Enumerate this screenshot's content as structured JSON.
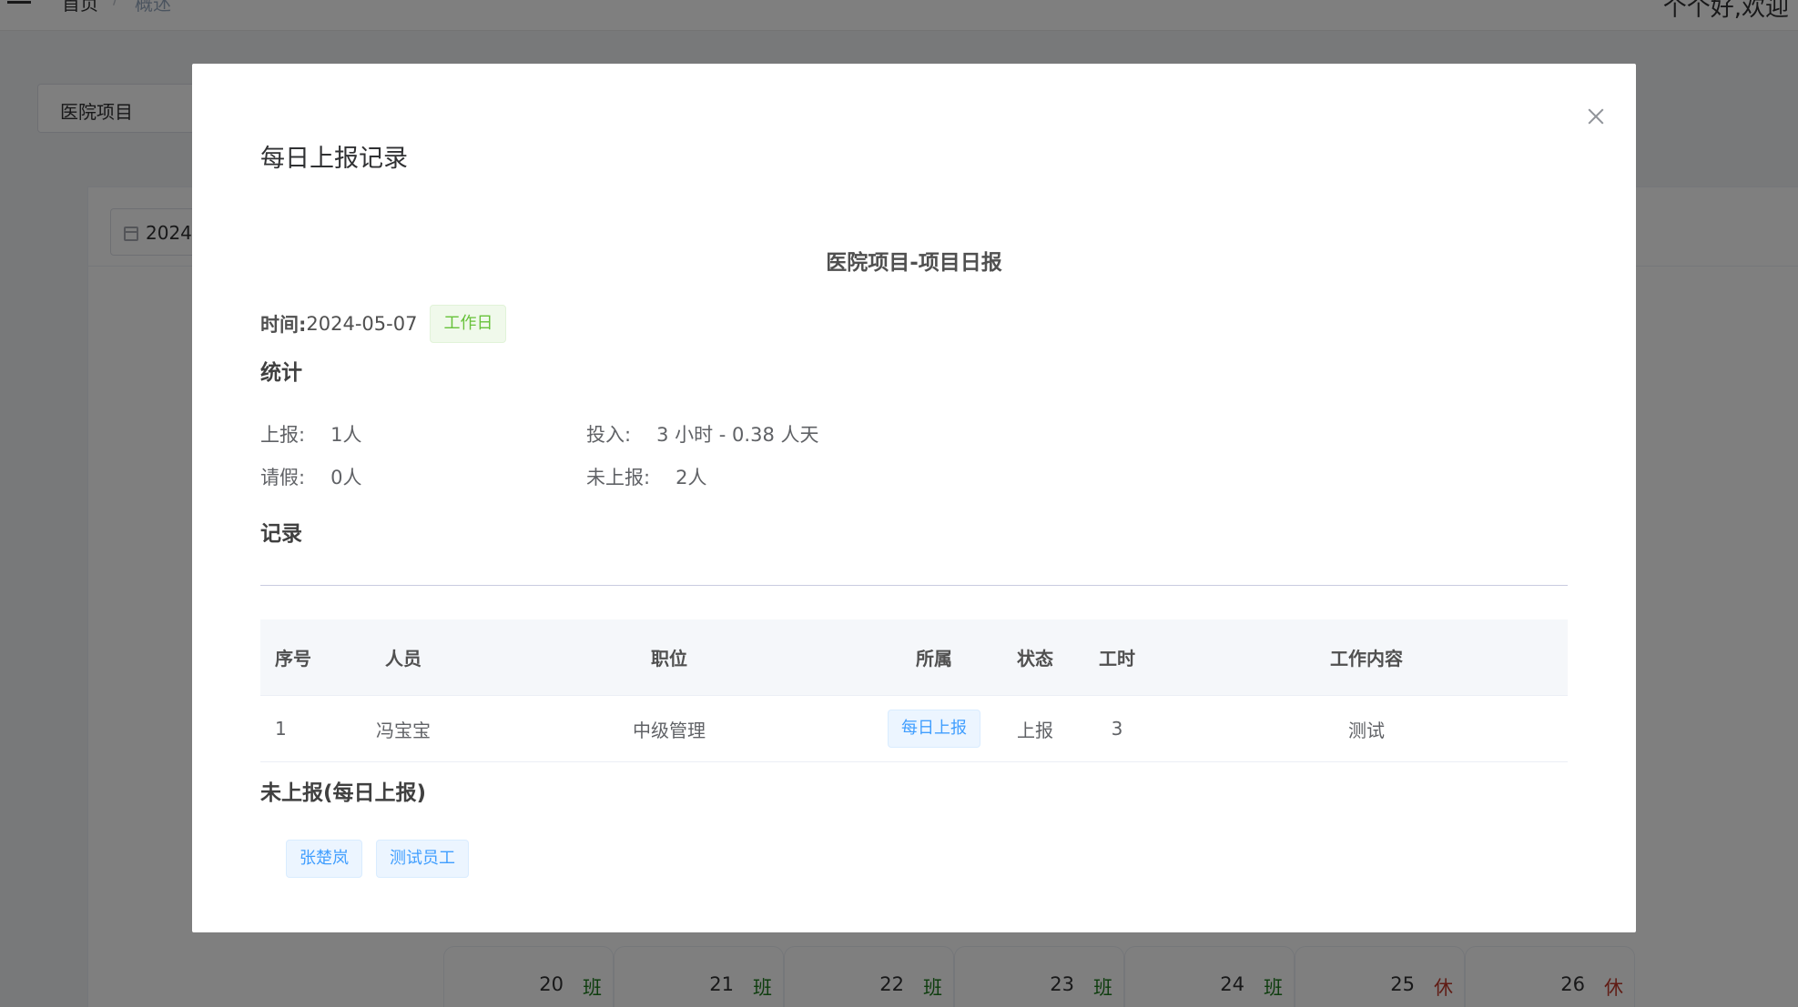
{
  "background": {
    "breadcrumb": [
      "首页",
      "/",
      "概述"
    ],
    "user_label": "个个好,欢迎",
    "project_select_value": "医院项目",
    "date_picker_value": "2024",
    "calendar_days": [
      {
        "day": "20",
        "mark": "班",
        "type": "work"
      },
      {
        "day": "21",
        "mark": "班",
        "type": "work"
      },
      {
        "day": "22",
        "mark": "班",
        "type": "work"
      },
      {
        "day": "23",
        "mark": "班",
        "type": "work"
      },
      {
        "day": "24",
        "mark": "班",
        "type": "work"
      },
      {
        "day": "25",
        "mark": "休",
        "type": "rest"
      },
      {
        "day": "26",
        "mark": "休",
        "type": "rest"
      }
    ]
  },
  "dialog": {
    "title": "每日上报记录",
    "report_title": "医院项目-项目日报",
    "time_label": "时间:",
    "time_value": "2024-05-07",
    "day_type_tag": "工作日",
    "stats_title": "统计",
    "stats": {
      "reported_label": "上报:",
      "reported_value": "1人",
      "input_label": "投入:",
      "input_value": "3 小时 - 0.38 人天",
      "leave_label": "请假:",
      "leave_value": "0人",
      "unreported_label": "未上报:",
      "unreported_value": "2人"
    },
    "records_title": "记录",
    "table": {
      "headers": [
        "序号",
        "人员",
        "职位",
        "所属",
        "状态",
        "工时",
        "工作内容"
      ],
      "rows": [
        {
          "index": "1",
          "person": "冯宝宝",
          "position": "中级管理",
          "belongs": "每日上报",
          "status": "上报",
          "hours": "3",
          "content": "测试"
        }
      ]
    },
    "unreported_title": "未上报(每日上报)",
    "unreported_people": [
      "张楚岚",
      "测试员工"
    ]
  },
  "colors": {
    "overlay": "rgba(0,0,0,0.5)",
    "tag_green_text": "#67c23a",
    "tag_blue_text": "#409eff",
    "work_mark": "#1b7a1b",
    "rest_mark": "#c0392b"
  }
}
